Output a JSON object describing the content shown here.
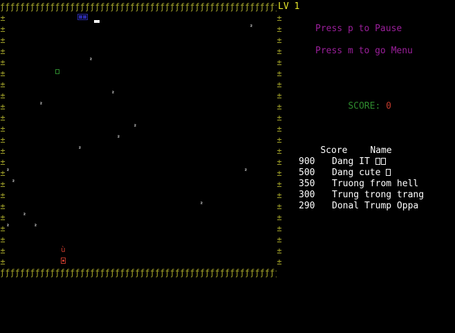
{
  "game": {
    "level_label": "LV 1",
    "pause_hint": "Press p to Pause",
    "menu_hint": "Press m to go Menu",
    "score_label": "SCORE: ",
    "score_value": "0",
    "wall_char": "±",
    "top_wall_char": "ƒ",
    "obstacle_char": "²"
  },
  "highscores": {
    "header_score": "Score",
    "header_name": "Name",
    "entries": [
      {
        "score": "900",
        "name": "Dang IT",
        "glyphs": 2
      },
      {
        "score": "500",
        "name": "Dang cute",
        "glyphs": 1
      },
      {
        "score": "350",
        "name": "Truong from hell",
        "glyphs": 0
      },
      {
        "score": "300",
        "name": "Trung trong trang",
        "glyphs": 0
      },
      {
        "score": "290",
        "name": "Donal Trump Oppa",
        "glyphs": 0
      }
    ]
  },
  "colors": {
    "wall": "#a5a52a",
    "hint": "#9b1f9b",
    "level": "#e6e62a",
    "score_label": "#2e8b2e",
    "score_value": "#c0392b",
    "player": "#2a2aa5",
    "enemy": "#c0392b",
    "food": "#2e8b2e"
  },
  "icons": {
    "player": "blue-snake-icon",
    "food": "food-icon",
    "enemy": "red-snake-icon",
    "obstacle": "obstacle-icon"
  }
}
